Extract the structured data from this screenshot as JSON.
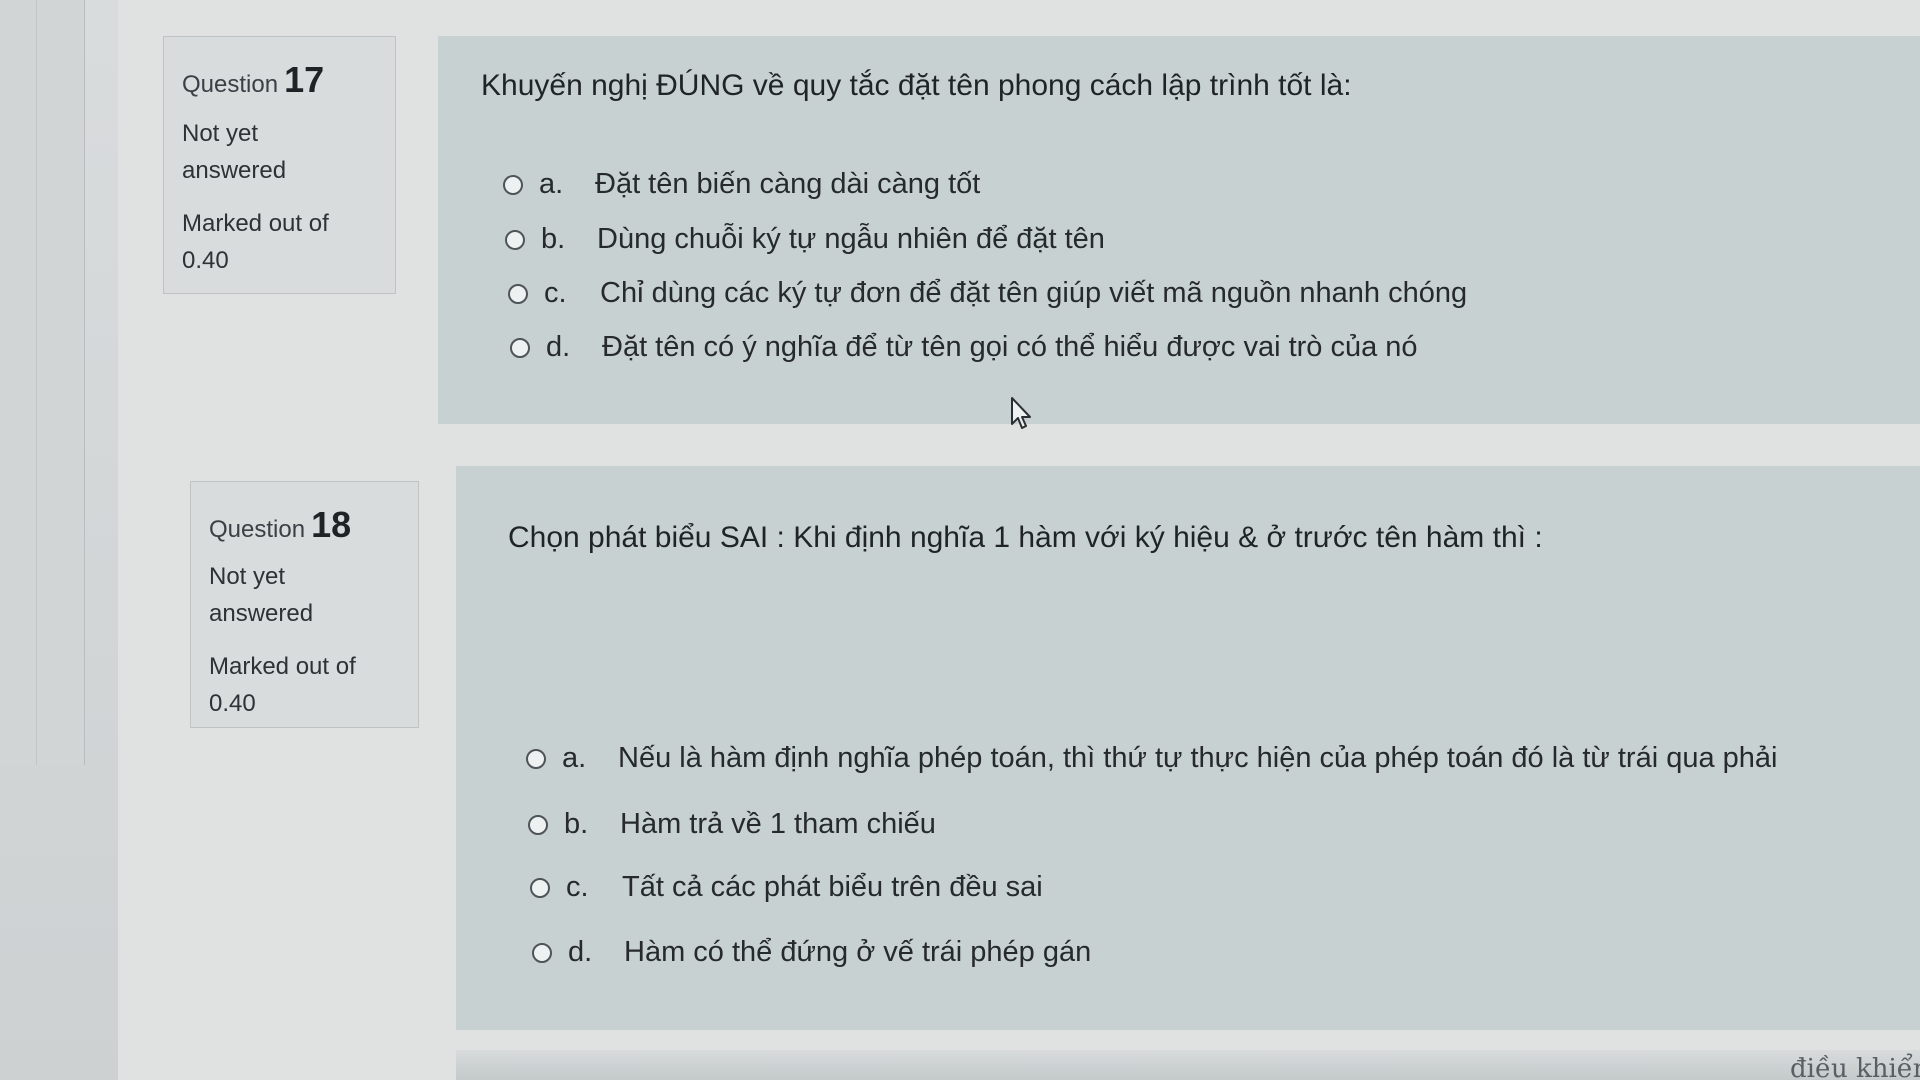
{
  "questions": [
    {
      "label": "Question",
      "number": "17",
      "status_line1": "Not yet",
      "status_line2": "answered",
      "marked_line1": "Marked out of",
      "marked_line2": "0.40",
      "text": "Khuyến nghị ĐÚNG về quy tắc đặt tên phong cách lập trình tốt là:",
      "options": [
        {
          "letter": "a.",
          "text": "Đặt tên biến càng dài càng tốt"
        },
        {
          "letter": "b.",
          "text": "Dùng chuỗi ký tự ngẫu nhiên để đặt tên"
        },
        {
          "letter": "c.",
          "text": "Chỉ dùng các ký tự đơn để đặt tên giúp viết mã nguồn nhanh chóng"
        },
        {
          "letter": "d.",
          "text": "Đặt tên có ý nghĩa để từ tên gọi có thể hiểu được vai trò của nó"
        }
      ]
    },
    {
      "label": "Question",
      "number": "18",
      "status_line1": "Not yet",
      "status_line2": "answered",
      "marked_line1": "Marked out of",
      "marked_line2": "0.40",
      "text": "Chọn phát biểu SAI : Khi  định nghĩa 1 hàm với ký hiệu & ở trước tên hàm  thì :",
      "options": [
        {
          "letter": "a.",
          "text": "Nếu là hàm định nghĩa phép toán, thì thứ tự thực hiện của phép toán đó là từ trái qua phải"
        },
        {
          "letter": "b.",
          "text": "Hàm trả về 1 tham chiếu"
        },
        {
          "letter": "c.",
          "text": "Tất cả các phát biểu trên đều sai"
        },
        {
          "letter": "d.",
          "text": "Hàm có thể đứng ở vế trái phép gán"
        }
      ]
    }
  ],
  "footer_partial_text": "điều khiển",
  "icons": {
    "cursor": "mouse-pointer-icon",
    "radio": "radio-button-unchecked"
  },
  "colors": {
    "page_bg": "#e0e2e2",
    "info_box_bg": "#d9dcdc",
    "content_bg": "#c8d1d2"
  }
}
